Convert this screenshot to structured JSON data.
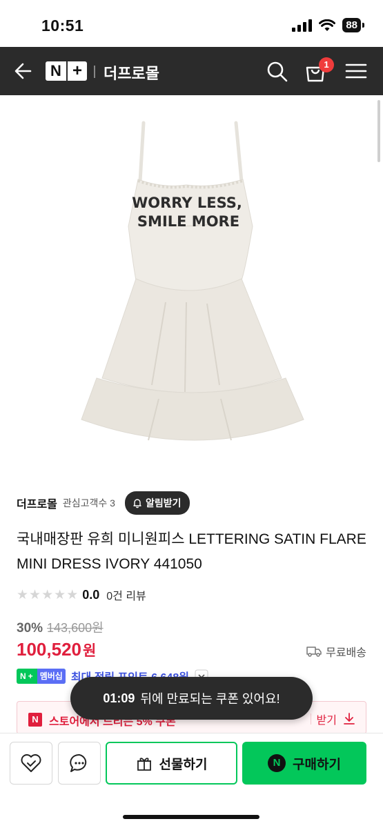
{
  "status_bar": {
    "time": "10:51",
    "battery": "88"
  },
  "header": {
    "logo_n": "N",
    "logo_plus": "+",
    "store_title": "더프로몰",
    "cart_count": "1"
  },
  "product_image": {
    "print_line1": "WORRY LESS,",
    "print_line2": "SMILE MORE"
  },
  "store": {
    "name": "더프로몰",
    "fav_label": "관심고객수 3",
    "alarm_label": "알림받기"
  },
  "product": {
    "title": "국내매장판 유희 미니원피스 LETTERING SATIN FLARE MINI DRESS IVORY 441050",
    "rating": "0.0",
    "review_count": "0건 리뷰",
    "discount": "30%",
    "original_price": "143,600원",
    "sale_price": "100,520",
    "currency": "원",
    "shipping": "무료배송"
  },
  "membership": {
    "badge_n": "N",
    "badge_plus": "+",
    "badge_label": "멤버십",
    "points": "최대 적립 포인트 6,648원"
  },
  "coupon": {
    "icon": "N",
    "text": "스토어에서 드리는 5% 쿠폰",
    "download": "받기"
  },
  "toast": {
    "timer": "01:09",
    "message": "뒤에 만료되는 쿠폰 있어요!"
  },
  "bottom_bar": {
    "gift_label": "선물하기",
    "buy_label": "구매하기",
    "buy_icon": "N"
  },
  "colors": {
    "header_bg": "#2b2b2b",
    "sale_red": "#e01f3d",
    "naver_green": "#03c75a",
    "points_blue": "#3d52e0"
  }
}
